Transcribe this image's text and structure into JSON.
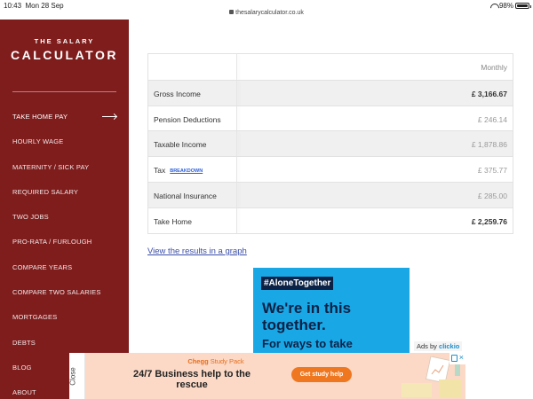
{
  "status_bar": {
    "time": "10:43",
    "date": "Mon 28 Sep",
    "url": "thesalarycalculator.co.uk",
    "battery": "98%",
    "battery_level": 0.98
  },
  "sidebar": {
    "logo_small": "THE SALARY",
    "logo_big": "CALCULATOR",
    "items": [
      {
        "label": "TAKE HOME PAY",
        "active": true
      },
      {
        "label": "HOURLY WAGE"
      },
      {
        "label": "MATERNITY / SICK PAY"
      },
      {
        "label": "REQUIRED SALARY"
      },
      {
        "label": "TWO JOBS"
      },
      {
        "label": "PRO-RATA / FURLOUGH"
      },
      {
        "label": "COMPARE YEARS"
      },
      {
        "label": "COMPARE TWO SALARIES"
      },
      {
        "label": "MORTGAGES"
      },
      {
        "label": "DEBTS"
      },
      {
        "label": "BLOG"
      },
      {
        "label": "ABOUT"
      }
    ]
  },
  "results": {
    "column_header": "Monthly",
    "rows": [
      {
        "label": "Gross Income",
        "value": "£ 3,166.67"
      },
      {
        "label": "Pension Deductions",
        "value": "£ 246.14"
      },
      {
        "label": "Taxable Income",
        "value": "£ 1,878.86"
      },
      {
        "label": "Tax",
        "link": "BREAKDOWN",
        "value": "£ 375.77"
      },
      {
        "label": "National Insurance",
        "value": "£ 285.00"
      },
      {
        "label": "Take Home",
        "value": "£ 2,259.76"
      }
    ],
    "graph_link": "View the results in a graph"
  },
  "ad_blue": {
    "hashtag": "#AloneTogether",
    "line1": "We're in this",
    "line2": "together.",
    "line3": "For ways to take"
  },
  "ads_by": {
    "prefix": "Ads by",
    "brand": "clickio"
  },
  "banner": {
    "close_label": "Close",
    "brand_bold": "Chegg",
    "brand_rest": " Study Pack",
    "headline": "24/7 Business help to the rescue",
    "cta": "Get study help"
  },
  "colors": {
    "sidebar": "#7f1d1d",
    "link": "#3a4ea8",
    "ad_blue": "#1aa7e6",
    "banner_bg": "#fbd9c6",
    "cta": "#ef7720"
  }
}
